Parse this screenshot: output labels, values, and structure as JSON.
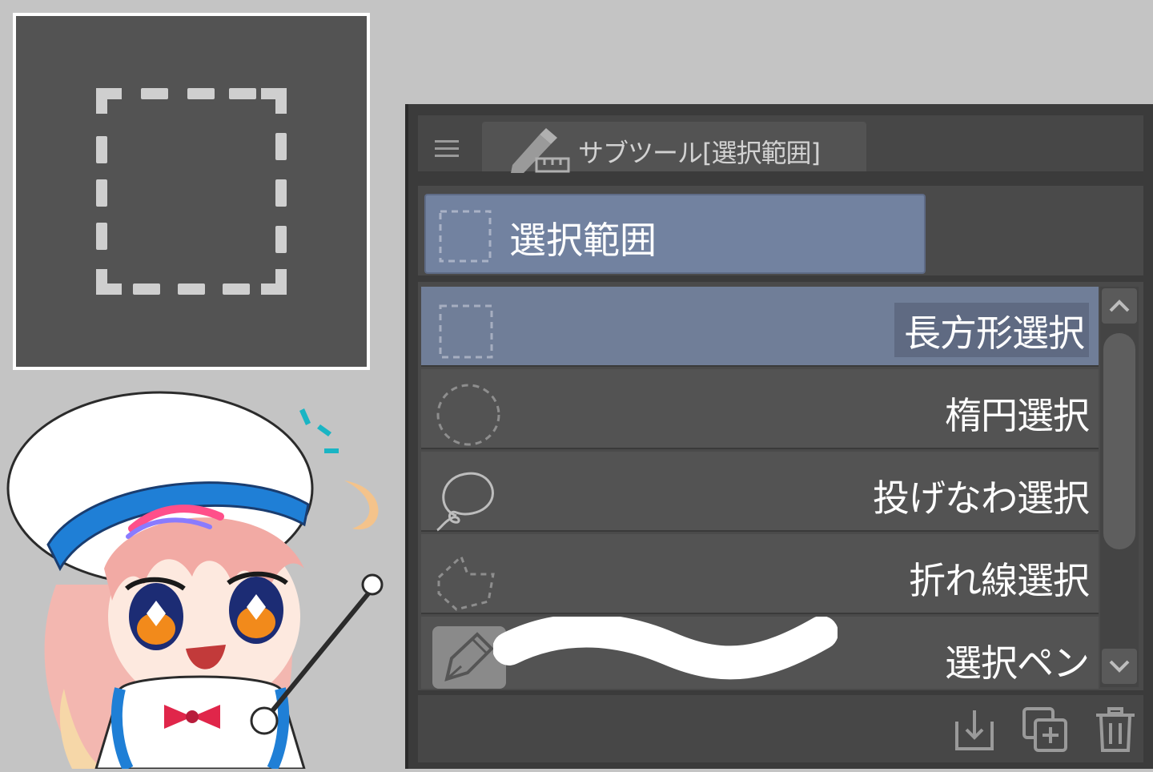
{
  "preview": {
    "icon": "rectangle-selection-icon"
  },
  "mascot": {
    "icon": "mascot-character"
  },
  "panel": {
    "menu_icon": "hamburger-menu-icon",
    "tab": {
      "icon": "pencil-ruler-icon",
      "label": "サブツール[選択範囲]"
    },
    "group": {
      "icon": "rectangle-selection-icon",
      "label": "選択範囲"
    },
    "tools": [
      {
        "label": "長方形選択",
        "icon": "rectangle-selection-icon",
        "selected": true
      },
      {
        "label": "楕円選択",
        "icon": "ellipse-selection-icon",
        "selected": false
      },
      {
        "label": "投げなわ選択",
        "icon": "lasso-selection-icon",
        "selected": false
      },
      {
        "label": "折れ線選択",
        "icon": "polyline-selection-icon",
        "selected": false
      },
      {
        "label": "選択ペン",
        "icon": "selection-pen-icon",
        "selected": false
      }
    ],
    "scrollbar": {
      "up_icon": "chevron-up-icon",
      "down_icon": "chevron-down-icon"
    },
    "footer": {
      "buttons": [
        {
          "icon": "import-download-icon"
        },
        {
          "icon": "duplicate-add-icon"
        },
        {
          "icon": "trash-icon"
        }
      ]
    }
  }
}
